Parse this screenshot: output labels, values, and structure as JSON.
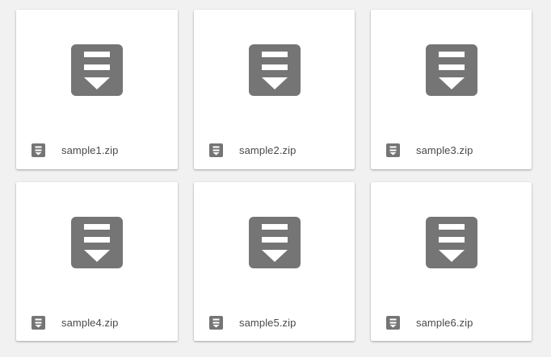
{
  "colors": {
    "background": "#f1f1f1",
    "card": "#ffffff",
    "icon": "#757575",
    "text": "#4a4a4a"
  },
  "icons": {
    "thumbnail": "archive-download-icon",
    "file_type": "archive-file-icon"
  },
  "files": [
    {
      "name": "sample1.zip"
    },
    {
      "name": "sample2.zip"
    },
    {
      "name": "sample3.zip"
    },
    {
      "name": "sample4.zip"
    },
    {
      "name": "sample5.zip"
    },
    {
      "name": "sample6.zip"
    }
  ]
}
